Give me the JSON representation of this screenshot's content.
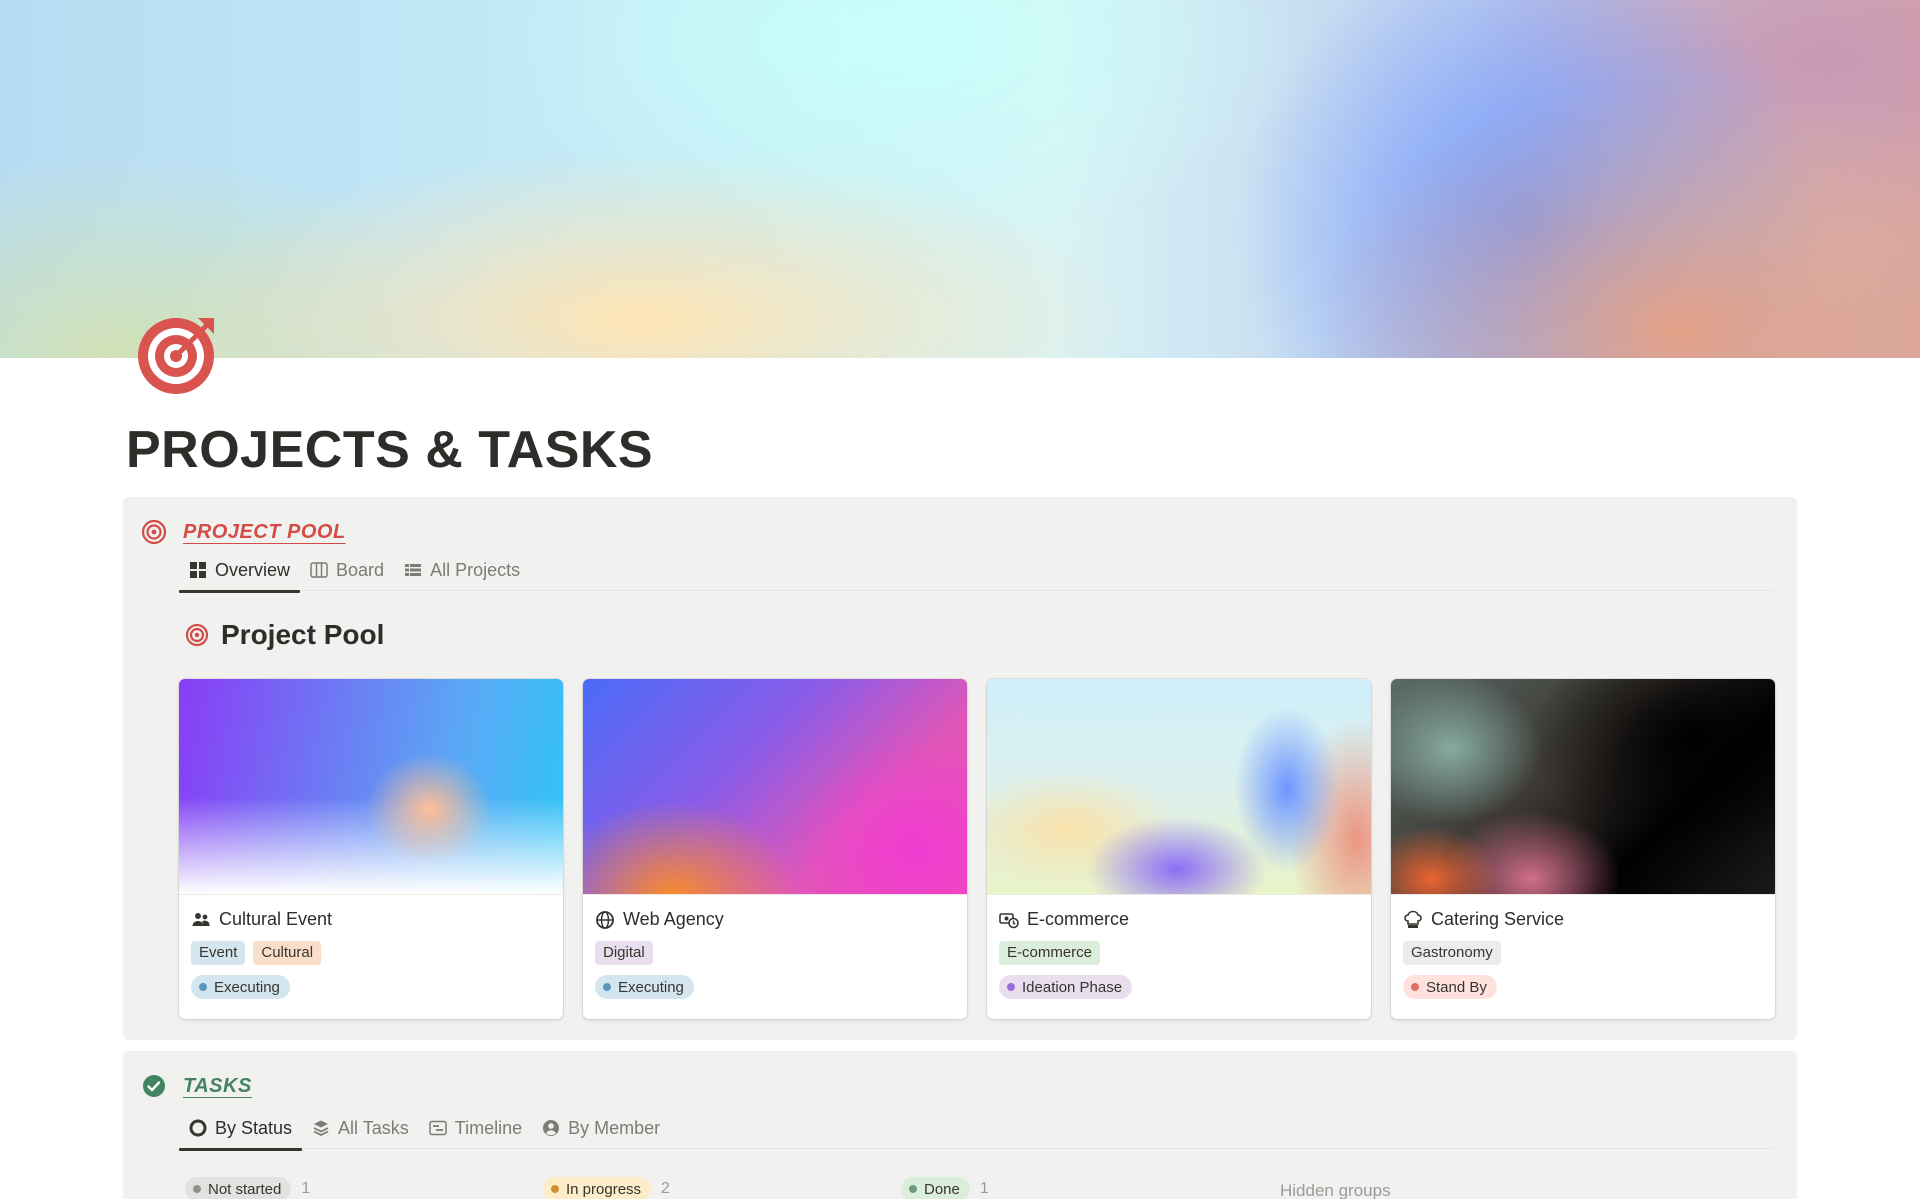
{
  "page": {
    "title": "PROJECTS & TASKS",
    "icon": "target-icon"
  },
  "colors": {
    "red": "#d44c47",
    "green": "#448361",
    "callout_bg": "#f1f1ef"
  },
  "project_pool": {
    "title": "PROJECT POOL",
    "icon": "target-icon",
    "tabs": [
      {
        "label": "Overview",
        "icon": "grid-icon",
        "active": true
      },
      {
        "label": "Board",
        "icon": "board-columns-icon",
        "active": false
      },
      {
        "label": "All Projects",
        "icon": "table-list-icon",
        "active": false
      }
    ],
    "view_title": "Project Pool",
    "cards": [
      {
        "name": "Cultural Event",
        "icon": "people-icon",
        "tags": [
          {
            "label": "Event",
            "bg": "#d3e5ef"
          },
          {
            "label": "Cultural",
            "bg": "#fadec9"
          }
        ],
        "status": {
          "label": "Executing",
          "bg": "#d3e5ef",
          "dot": "#5b97bd"
        }
      },
      {
        "name": "Web Agency",
        "icon": "globe-icon",
        "tags": [
          {
            "label": "Digital",
            "bg": "#e8deee"
          }
        ],
        "status": {
          "label": "Executing",
          "bg": "#d3e5ef",
          "dot": "#5b97bd"
        }
      },
      {
        "name": "E-commerce",
        "icon": "money-cycle-icon",
        "tags": [
          {
            "label": "E-commerce",
            "bg": "#dbeddb"
          }
        ],
        "status": {
          "label": "Ideation Phase",
          "bg": "#e8deee",
          "dot": "#9a6dd7"
        }
      },
      {
        "name": "Catering Service",
        "icon": "chef-hat-icon",
        "tags": [
          {
            "label": "Gastronomy",
            "bg": "#ebeced"
          }
        ],
        "status": {
          "label": "Stand By",
          "bg": "#ffe2dd",
          "dot": "#e16f64"
        }
      }
    ]
  },
  "tasks": {
    "title": "TASKS",
    "icon": "check-circle-icon",
    "tabs": [
      {
        "label": "By Status",
        "icon": "circle-icon",
        "active": true
      },
      {
        "label": "All Tasks",
        "icon": "layers-icon",
        "active": false
      },
      {
        "label": "Timeline",
        "icon": "timeline-icon",
        "active": false
      },
      {
        "label": "By Member",
        "icon": "user-circle-icon",
        "active": false
      }
    ],
    "groups": [
      {
        "label": "Not started",
        "count": "1",
        "bg": "#e3e2e0",
        "dot": "#91918e"
      },
      {
        "label": "In progress",
        "count": "2",
        "bg": "#fdecc8",
        "dot": "#cb912f"
      },
      {
        "label": "Done",
        "count": "1",
        "bg": "#dbeddb",
        "dot": "#6c9b7d"
      }
    ],
    "hidden_groups_label": "Hidden groups"
  }
}
